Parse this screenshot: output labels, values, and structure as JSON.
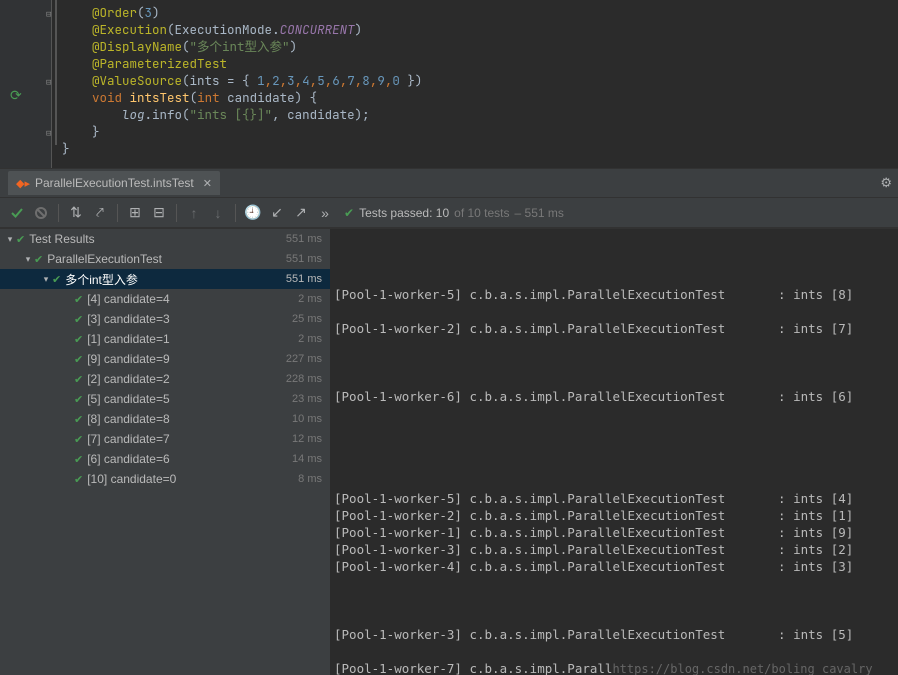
{
  "code": {
    "annotations": {
      "order": "@Order",
      "order_num": "3",
      "execution": "@Execution",
      "execution_class": "ExecutionMode",
      "execution_val": "CONCURRENT",
      "displayName": "@DisplayName",
      "displayName_val": "\"多个int型入参\"",
      "parameterized": "@ParameterizedTest",
      "valueSource": "@ValueSource",
      "valueSource_param": "ints = { ",
      "values": [
        "1",
        "2",
        "3",
        "4",
        "5",
        "6",
        "7",
        "8",
        "9",
        "0"
      ],
      "valueSource_close": " }"
    },
    "method": {
      "kw_void": "void",
      "name": "intsTest",
      "param_type": "int",
      "param_name": "candidate",
      "open": ") {",
      "log_ident": "log",
      "log_method": ".info(",
      "log_fmt": "\"ints [{}]\"",
      "log_sep": ", ",
      "log_arg": "candidate",
      "log_close": ");",
      "close": "}"
    },
    "close_brace": "}"
  },
  "tab": {
    "label": "ParallelExecutionTest.intsTest"
  },
  "status": {
    "passed_label": "Tests passed:",
    "passed_count": "10",
    "of_text": "of 10 tests",
    "time": "– 551 ms"
  },
  "tree": {
    "root": {
      "label": "Test Results",
      "ms": "551 ms"
    },
    "class": {
      "label": "ParallelExecutionTest",
      "ms": "551 ms"
    },
    "group": {
      "label": "多个int型入参",
      "ms": "551 ms"
    },
    "items": [
      {
        "label": "[4] candidate=4",
        "ms": "2 ms"
      },
      {
        "label": "[3] candidate=3",
        "ms": "25 ms"
      },
      {
        "label": "[1] candidate=1",
        "ms": "2 ms"
      },
      {
        "label": "[9] candidate=9",
        "ms": "227 ms"
      },
      {
        "label": "[2] candidate=2",
        "ms": "228 ms"
      },
      {
        "label": "[5] candidate=5",
        "ms": "23 ms"
      },
      {
        "label": "[8] candidate=8",
        "ms": "10 ms"
      },
      {
        "label": "[7] candidate=7",
        "ms": "12 ms"
      },
      {
        "label": "[6] candidate=6",
        "ms": "14 ms"
      },
      {
        "label": "[10] candidate=0",
        "ms": "8 ms"
      }
    ]
  },
  "console": {
    "lines": [
      "",
      "[Pool-1-worker-5] c.b.a.s.impl.ParallelExecutionTest       : ints [8]",
      "",
      "[Pool-1-worker-2] c.b.a.s.impl.ParallelExecutionTest       : ints [7]",
      "",
      "",
      "",
      "[Pool-1-worker-6] c.b.a.s.impl.ParallelExecutionTest       : ints [6]",
      "",
      "",
      "",
      "",
      "",
      "[Pool-1-worker-5] c.b.a.s.impl.ParallelExecutionTest       : ints [4]",
      "[Pool-1-worker-2] c.b.a.s.impl.ParallelExecutionTest       : ints [1]",
      "[Pool-1-worker-1] c.b.a.s.impl.ParallelExecutionTest       : ints [9]",
      "[Pool-1-worker-3] c.b.a.s.impl.ParallelExecutionTest       : ints [2]",
      "[Pool-1-worker-4] c.b.a.s.impl.ParallelExecutionTest       : ints [3]",
      "",
      "",
      "",
      "[Pool-1-worker-3] c.b.a.s.impl.ParallelExecutionTest       : ints [5]",
      ""
    ],
    "last_line_a": "[Pool-1-worker-7] c.b.a.s.impl.Parall",
    "watermark": "https://blog.csdn.net/boling_cavalry"
  }
}
